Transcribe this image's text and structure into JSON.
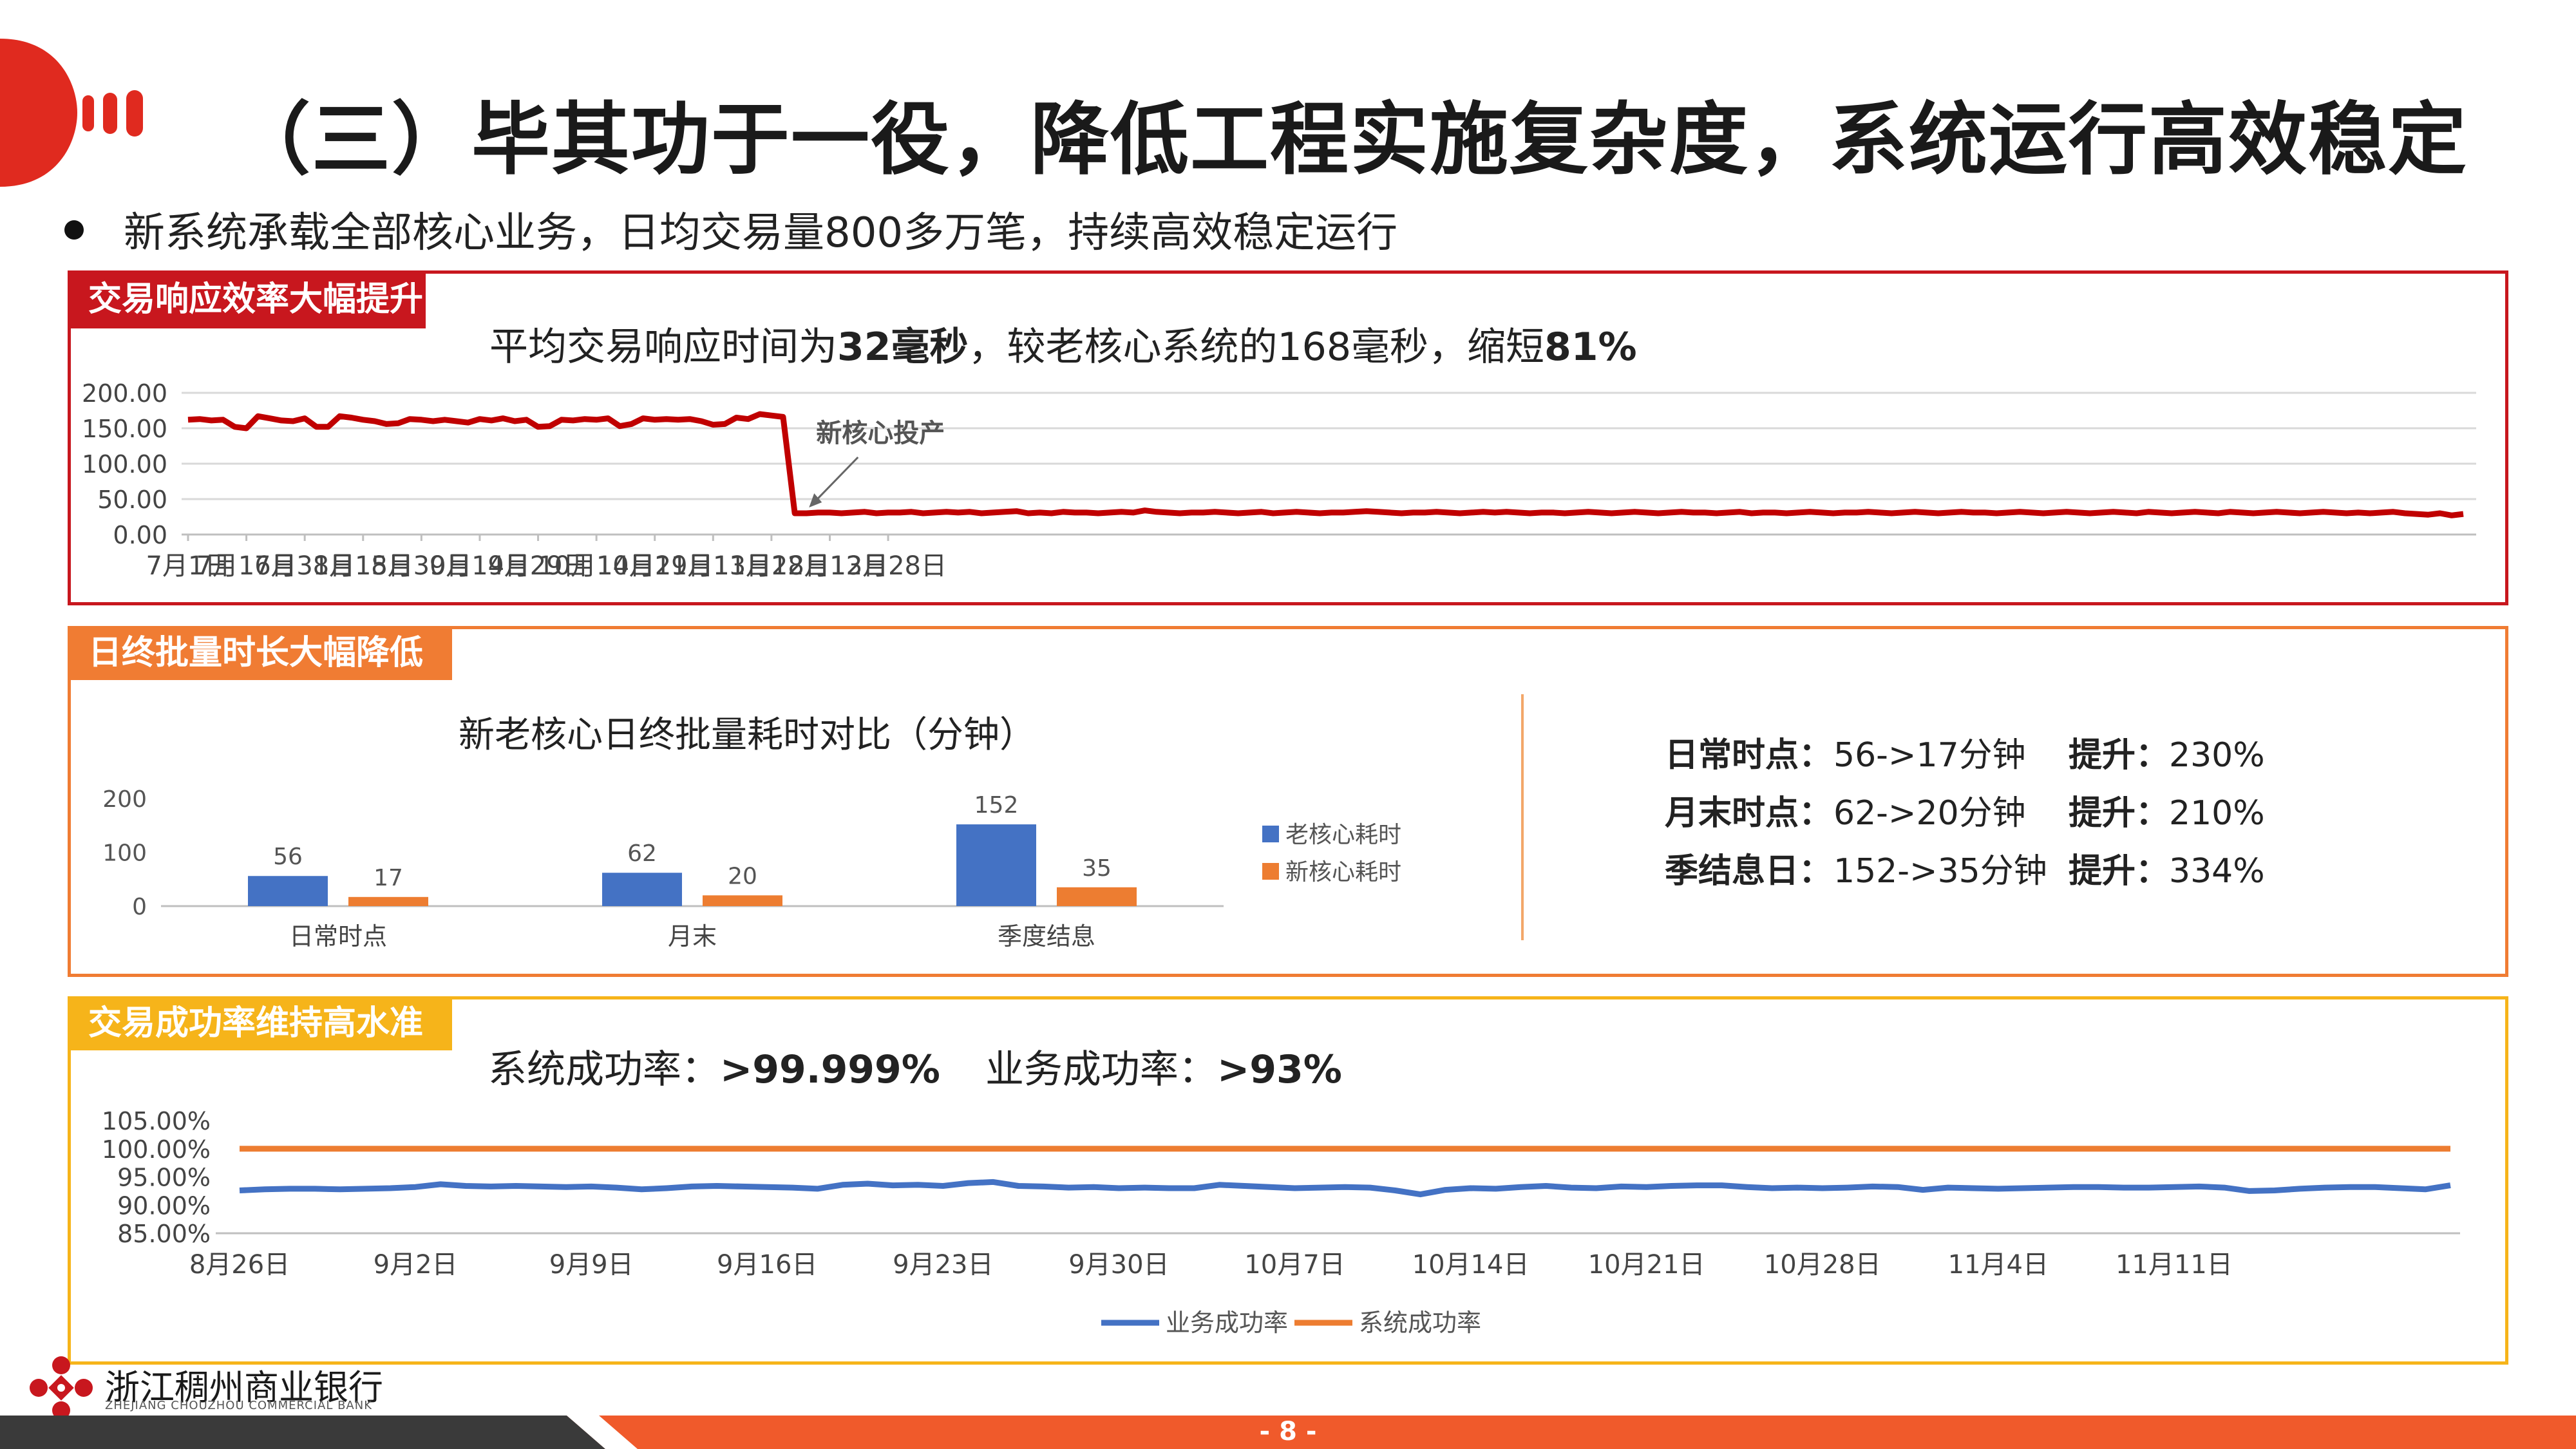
{
  "header": {
    "title": "（三）毕其功于一役，降低工程实施复杂度，系统运行高效稳定",
    "bullet": "新系统承载全部核心业务，日均交易量800多万笔，持续高效稳定运行"
  },
  "panel1": {
    "tag": "交易响应效率大幅提升",
    "headline_pre": "平均交易响应时间为",
    "headline_b1": "32毫秒",
    "headline_mid": "，较老核心系统的168毫秒，缩短",
    "headline_b2": "81%",
    "annotation": "新核心投产",
    "colors": {
      "line": "#c00000",
      "frame": "#c8171e"
    }
  },
  "panel2": {
    "tag": "日终批量时长大幅降低",
    "stats": [
      {
        "label": "日常时点：",
        "value": "56->17分钟",
        "imp_label": "提升：",
        "imp_value": "230%"
      },
      {
        "label": "月末时点：",
        "value": "62->20分钟",
        "imp_label": "提升：",
        "imp_value": "210%"
      },
      {
        "label": "季结息日：",
        "value": "152->35分钟",
        "imp_label": "提升：",
        "imp_value": "334%"
      }
    ],
    "colors": {
      "old": "#4472c4",
      "new": "#ed7d31",
      "frame": "#f07c33"
    }
  },
  "panel3": {
    "tag": "交易成功率维持高水准",
    "headline_a": "系统成功率：",
    "headline_a_b": ">99.999%",
    "headline_b": "业务成功率：",
    "headline_b_b": ">93%",
    "colors": {
      "business": "#4472c4",
      "system": "#ed7d31",
      "frame": "#f6b41a"
    }
  },
  "footer": {
    "bank_cn": "浙江稠州商业银行",
    "bank_en": "ZHEJIANG CHOUZHOU COMMERCIAL BANK",
    "page": "- 8 -"
  },
  "chart_data": [
    {
      "type": "line",
      "title": "",
      "x_ticks": [
        "7月1日",
        "7月16日",
        "7月31日",
        "8月15日",
        "8月30日",
        "9月14日",
        "9月29日",
        "10月14日",
        "10月29日",
        "11月13日",
        "11月28日",
        "12月13日",
        "12月28日"
      ],
      "x_start": "7月1日",
      "x_step": "3天",
      "y_ticks": [
        "0.00",
        "50.00",
        "100.00",
        "150.00",
        "200.00"
      ],
      "ylim": [
        0,
        200
      ],
      "grid": true,
      "series": [
        {
          "values": [
            162,
            163,
            161,
            162,
            152,
            150,
            167,
            164,
            161,
            160,
            164,
            152,
            152,
            167,
            165,
            162,
            160,
            156,
            157,
            163,
            162,
            160,
            162,
            160,
            158,
            163,
            161,
            164,
            160,
            162,
            152,
            153,
            162,
            161,
            163,
            162,
            164,
            153,
            156,
            164,
            162,
            163,
            162,
            163,
            160,
            155,
            156,
            165,
            163,
            170,
            168,
            166,
            30,
            30,
            31,
            31,
            30,
            31,
            32,
            30,
            31,
            31,
            32,
            30,
            31,
            32,
            31,
            32,
            30,
            31,
            32,
            33,
            30,
            31,
            30,
            32,
            31,
            31,
            30,
            31,
            32,
            31,
            34,
            32,
            31,
            30,
            31,
            31,
            32,
            31,
            30,
            31,
            32,
            30,
            31,
            32,
            31,
            30,
            31,
            31,
            32,
            33,
            32,
            31,
            30,
            31,
            31,
            32,
            31,
            30,
            31,
            32,
            31,
            32,
            31,
            30,
            31,
            31,
            30,
            31,
            32,
            31,
            30,
            31,
            32,
            31,
            30,
            31,
            32,
            31,
            31,
            30,
            31,
            32,
            30,
            31,
            31,
            30,
            31,
            32,
            31,
            30,
            31,
            31,
            32,
            31,
            30,
            31,
            32,
            31,
            30,
            31,
            32,
            31,
            31,
            30,
            31,
            32,
            31,
            30,
            31,
            32,
            31,
            30,
            31,
            32,
            31,
            30,
            32,
            31,
            30,
            31,
            32,
            31,
            30,
            32,
            31,
            30,
            31,
            32,
            31,
            30,
            31,
            32,
            31,
            30,
            31,
            30,
            31,
            32,
            30,
            29,
            28,
            30,
            27,
            29
          ]
        }
      ]
    },
    {
      "type": "bar",
      "title": "新老核心日终批量耗时对比（分钟）",
      "categories": [
        "日常时点",
        "月末",
        "季度结息"
      ],
      "series": [
        {
          "name": "老核心耗时",
          "values": [
            56,
            62,
            152
          ]
        },
        {
          "name": "新核心耗时",
          "values": [
            17,
            20,
            35
          ]
        }
      ],
      "y_ticks": [
        "0",
        "100",
        "200"
      ],
      "ylim": [
        0,
        200
      ],
      "legend": "right"
    },
    {
      "type": "line",
      "title": "",
      "x_ticks": [
        "8月26日",
        "9月2日",
        "9月9日",
        "9月16日",
        "9月23日",
        "9月30日",
        "10月7日",
        "10月14日",
        "10月21日",
        "10月28日",
        "11月4日",
        "11月11日"
      ],
      "x_start": "8月26日",
      "x_step": "1天",
      "y_ticks": [
        "85.00%",
        "90.00%",
        "95.00%",
        "100.00%",
        "105.00%"
      ],
      "ylim": [
        85,
        105
      ],
      "legend": "bottom",
      "series": [
        {
          "name": "业务成功率",
          "values": [
            92.6,
            92.8,
            92.9,
            92.9,
            92.8,
            92.9,
            93.0,
            93.2,
            93.7,
            93.4,
            93.3,
            93.4,
            93.3,
            93.2,
            93.3,
            93.1,
            92.8,
            93.0,
            93.3,
            93.4,
            93.3,
            93.2,
            93.1,
            92.9,
            93.6,
            93.8,
            93.5,
            93.6,
            93.4,
            93.9,
            94.1,
            93.4,
            93.3,
            93.1,
            93.2,
            93.0,
            93.1,
            93.0,
            93.0,
            93.6,
            93.4,
            93.2,
            93.0,
            93.1,
            93.2,
            93.1,
            92.6,
            91.9,
            92.7,
            93.0,
            92.9,
            93.2,
            93.4,
            93.1,
            93.0,
            93.3,
            93.2,
            93.4,
            93.5,
            93.5,
            93.2,
            93.0,
            93.1,
            93.0,
            93.1,
            93.3,
            93.2,
            92.7,
            93.1,
            93.0,
            92.9,
            93.0,
            93.1,
            93.2,
            93.2,
            93.1,
            93.1,
            93.2,
            93.3,
            93.1,
            92.5,
            92.6,
            92.9,
            93.1,
            93.2,
            93.2,
            93.0,
            92.8,
            93.5
          ]
        },
        {
          "name": "系统成功率",
          "values": [
            99.999,
            99.999,
            99.999,
            99.999,
            99.999,
            99.999,
            99.999,
            99.999,
            99.999,
            99.999,
            99.999,
            99.999,
            99.999,
            99.999,
            99.999,
            99.999,
            99.999,
            99.999,
            99.999,
            99.999,
            99.999,
            99.999,
            99.999,
            99.999,
            99.999,
            99.999,
            99.999,
            99.999,
            99.999,
            99.999,
            99.999,
            99.999,
            99.999,
            99.999,
            99.999,
            99.999,
            99.999,
            99.999,
            99.999,
            99.999,
            99.999,
            99.999,
            99.999,
            99.999,
            99.999,
            99.999,
            99.999,
            99.999,
            99.999,
            99.999,
            99.999,
            99.999,
            99.999,
            99.999,
            99.999,
            99.999,
            99.999,
            99.999,
            99.999,
            99.999,
            99.999,
            99.999,
            99.999,
            99.999,
            99.999,
            99.999,
            99.999,
            99.999,
            99.999,
            99.999,
            99.999,
            99.999,
            99.999,
            99.999,
            99.999,
            99.999,
            99.999,
            99.999,
            99.999,
            99.999,
            99.999,
            99.999,
            99.999,
            99.999,
            99.999,
            99.999,
            99.999,
            99.999,
            99.999
          ]
        }
      ]
    }
  ]
}
